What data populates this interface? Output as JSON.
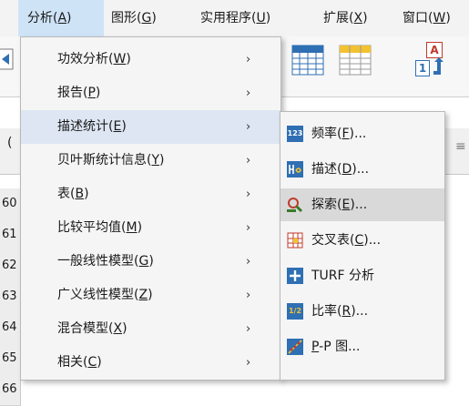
{
  "menubar": {
    "items": [
      {
        "label": "分析(",
        "mnemonic": "A",
        "tail": ")"
      },
      {
        "label": "图形(",
        "mnemonic": "G",
        "tail": ")"
      },
      {
        "label": "实用程序(",
        "mnemonic": "U",
        "tail": ")"
      },
      {
        "label": "扩展(",
        "mnemonic": "X",
        "tail": ")"
      },
      {
        "label": "窗口(",
        "mnemonic": "W",
        "tail": ")"
      }
    ]
  },
  "toolbar": {
    "icons": [
      "undo-icon",
      "grid-icon",
      "table-icon",
      "value-labels-icon"
    ],
    "value_label_letter": "A",
    "value_label_digit": "1"
  },
  "grid": {
    "header_fragment": "(",
    "header_fragment_right": "≡",
    "row_numbers": [
      "60",
      "61",
      "62",
      "63",
      "64",
      "65",
      "66"
    ]
  },
  "analyze_menu": {
    "items": [
      {
        "label": "功效分析(",
        "mnemonic": "W",
        "tail": ")"
      },
      {
        "label": "报告(",
        "mnemonic": "P",
        "tail": ")"
      },
      {
        "label": "描述统计(",
        "mnemonic": "E",
        "tail": ")"
      },
      {
        "label": "贝叶斯统计信息(",
        "mnemonic": "Y",
        "tail": ")"
      },
      {
        "label": "表(",
        "mnemonic": "B",
        "tail": ")"
      },
      {
        "label": "比较平均值(",
        "mnemonic": "M",
        "tail": ")"
      },
      {
        "label": "一般线性模型(",
        "mnemonic": "G",
        "tail": ")"
      },
      {
        "label": "广义线性模型(",
        "mnemonic": "Z",
        "tail": ")"
      },
      {
        "label": "混合模型(",
        "mnemonic": "X",
        "tail": ")"
      },
      {
        "label": "相关(",
        "mnemonic": "C",
        "tail": ")"
      }
    ],
    "arrow": "›"
  },
  "descriptives_submenu": {
    "items": [
      {
        "label": "频率(",
        "mnemonic": "F",
        "tail": ")...",
        "icon": "frequencies-icon",
        "icon_text": "123"
      },
      {
        "label": "描述(",
        "mnemonic": "D",
        "tail": ")...",
        "icon": "descriptives-icon",
        "icon_text": ""
      },
      {
        "label": "探索(",
        "mnemonic": "E",
        "tail": ")...",
        "icon": "explore-icon",
        "icon_text": ""
      },
      {
        "label": "交叉表(",
        "mnemonic": "C",
        "tail": ")...",
        "icon": "crosstabs-icon",
        "icon_text": ""
      },
      {
        "label": "TURF 分析",
        "mnemonic": "",
        "tail": "",
        "icon": "turf-icon",
        "icon_text": ""
      },
      {
        "label": "比率(",
        "mnemonic": "R",
        "tail": ")...",
        "icon": "ratio-icon",
        "icon_text": "1/2"
      },
      {
        "label": "",
        "mnemonic": "P",
        "tail": "-P 图...",
        "icon": "pp-plot-icon",
        "icon_text": ""
      }
    ]
  },
  "colors": {
    "menubar_active": "#cfe3f7",
    "menu_hover": "#dde6f2",
    "submenu_hover": "#d9d9d9",
    "icon_blue": "#2f6fb3"
  }
}
